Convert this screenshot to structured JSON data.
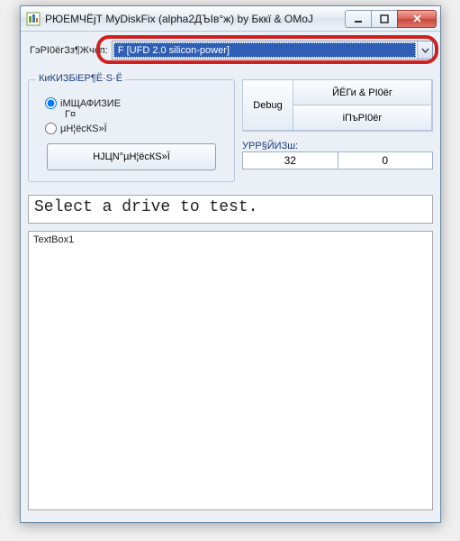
{
  "window": {
    "title": "РЮЕМЧЁјТ MyDiskFix (alpha2ДЪІв°ж) by Бккї & OMoJ"
  },
  "drive": {
    "label": "ГэРІ0ёгЗз¶Жчеп:",
    "selected": "F [UFD 2.0 silicon-power]"
  },
  "modeGroup": {
    "title": "КиКИЗБіЕР¶Ё·Ѕ·Ё",
    "opt1": "іМЩАФИЗИЕ",
    "opt1_sub": "Г¤",
    "opt2": "µН¦ёсКЅ»Ї",
    "button": "НЈЦN°µН¦ёсКЅ»Ї"
  },
  "actions": {
    "debug": "Debug",
    "btn1": "ЙЁГи & РІ0ёг",
    "btn2": "іПъРІ0ёг"
  },
  "stats": {
    "label": "УРР§ЙИЗш:",
    "val1": "32",
    "val2": "0"
  },
  "message": "Select a drive to test.",
  "log": "TextBox1"
}
